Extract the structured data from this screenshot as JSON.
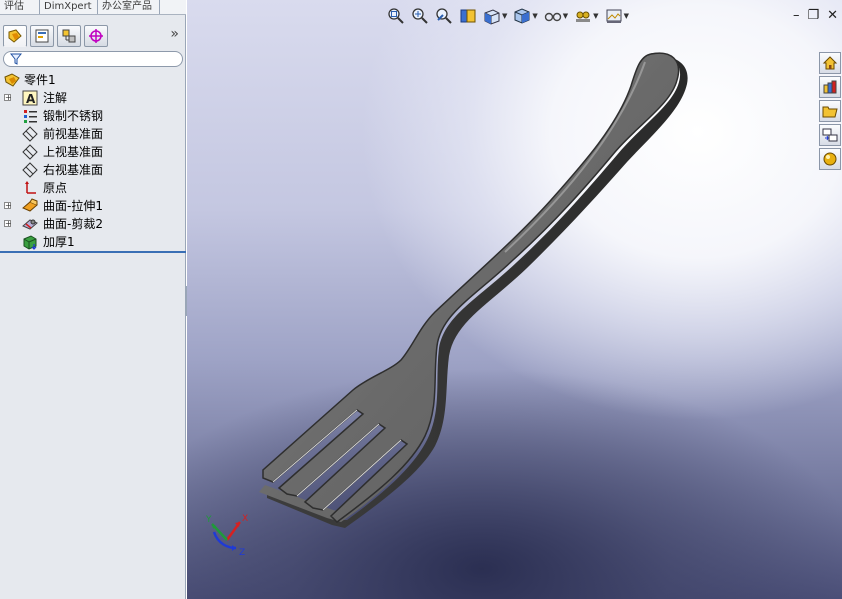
{
  "top_tabs": [
    "评估",
    "DimXpert",
    "办公室产品"
  ],
  "manager_tabs": [
    {
      "name": "feature-manager",
      "icon": "feature-tree-icon"
    },
    {
      "name": "property-manager",
      "icon": "property-manager-icon"
    },
    {
      "name": "configuration-manager",
      "icon": "configuration-manager-icon"
    },
    {
      "name": "dimxpert-manager",
      "icon": "dimxpert-target-icon"
    }
  ],
  "expand_glyph": "»",
  "tree": {
    "root": {
      "label": "零件1",
      "icon": "part-icon"
    },
    "items": [
      {
        "label": "注解",
        "icon": "annotation-icon",
        "expandable": true
      },
      {
        "label": "锻制不锈钢",
        "icon": "material-icon",
        "expandable": false
      },
      {
        "label": "前视基准面",
        "icon": "plane-icon",
        "expandable": false
      },
      {
        "label": "上视基准面",
        "icon": "plane-icon",
        "expandable": false
      },
      {
        "label": "右视基准面",
        "icon": "plane-icon",
        "expandable": false
      },
      {
        "label": "原点",
        "icon": "origin-icon",
        "expandable": false
      },
      {
        "label": "曲面-拉伸1",
        "icon": "surface-extrude-icon",
        "expandable": true
      },
      {
        "label": "曲面-剪裁2",
        "icon": "surface-trim-icon",
        "expandable": true
      },
      {
        "label": "加厚1",
        "icon": "thicken-icon",
        "expandable": false
      }
    ]
  },
  "view_toolbar": [
    {
      "icon": "zoom-to-fit-icon",
      "dropdown": false
    },
    {
      "icon": "zoom-to-area-icon",
      "dropdown": false
    },
    {
      "icon": "previous-view-icon",
      "dropdown": false
    },
    {
      "icon": "section-view-icon",
      "dropdown": false
    },
    {
      "icon": "view-orientation-icon",
      "dropdown": true
    },
    {
      "icon": "display-style-icon",
      "dropdown": true
    },
    {
      "icon": "hide-show-items-icon",
      "dropdown": true
    },
    {
      "icon": "edit-appearance-icon",
      "dropdown": true
    },
    {
      "icon": "apply-scene-icon",
      "dropdown": true
    }
  ],
  "window_controls": [
    "–",
    "❐",
    "✕"
  ],
  "task_pane": [
    "home-icon",
    "design-library-icon",
    "file-explorer-icon",
    "view-palette-icon",
    "appearances-icon"
  ],
  "triad": {
    "x": "X",
    "y": "Y",
    "z": "Z"
  },
  "colors": {
    "tree_selection_line": "#3a6fb5",
    "triad_x": "#d62020",
    "triad_y": "#1f9a3a",
    "triad_z": "#1f3ad6",
    "fork_body": "#6c6c6c"
  }
}
